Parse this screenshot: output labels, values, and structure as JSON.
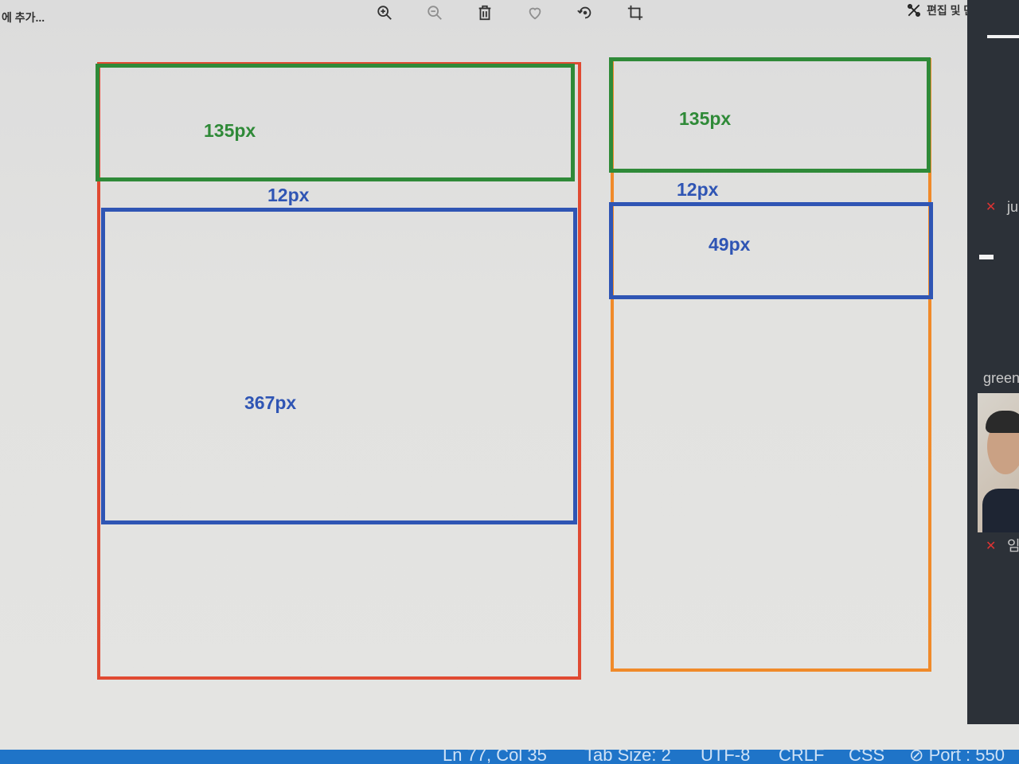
{
  "app": {
    "title": "에 추가..."
  },
  "toolbar": {
    "icons": [
      "zoom-in-icon",
      "zoom-out-icon",
      "delete-icon",
      "favorite-icon",
      "rotate-icon",
      "crop-icon"
    ],
    "edit_create_label": "편집 및 만들기"
  },
  "diagram": {
    "left": {
      "outer_color": "#e04a32",
      "header": {
        "label": "135px",
        "color": "#2f8a38"
      },
      "gap": {
        "label": "12px",
        "color": "#2f55b4"
      },
      "content": {
        "label": "367px",
        "color": "#2f55b4"
      }
    },
    "right": {
      "outer_color": "#f08a2a",
      "header": {
        "label": "135px",
        "color": "#2f8a38"
      },
      "gap": {
        "label": "12px",
        "color": "#2f55b4"
      },
      "content": {
        "label": "49px",
        "color": "#2f55b4"
      }
    }
  },
  "side_panel": {
    "participant_1": "ju",
    "participant_2": "green",
    "participant_3": "임"
  },
  "status_bar": {
    "position": "Ln 77, Col 35",
    "tab_size": "Tab Size: 2",
    "encoding": "UTF-8",
    "eol": "CRLF",
    "language": "CSS",
    "port": "Port : 550"
  }
}
